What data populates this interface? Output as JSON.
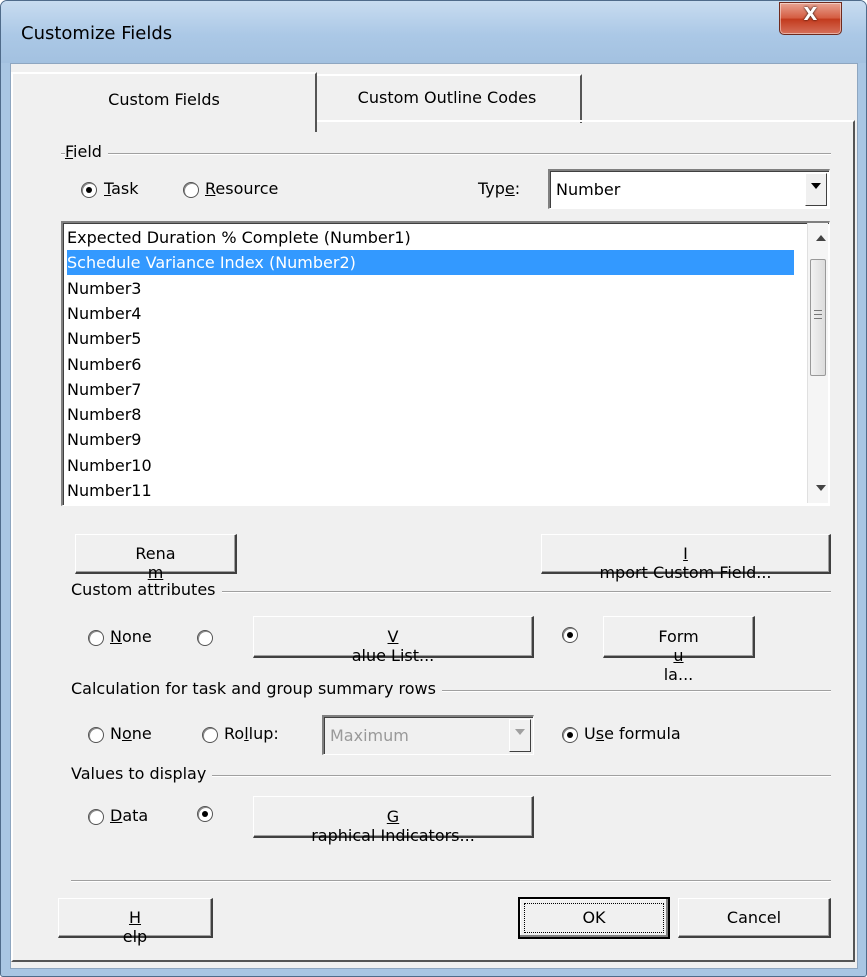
{
  "window": {
    "title": "Customize Fields",
    "close_glyph": "X"
  },
  "tabs": [
    {
      "label": "Custom Fields"
    },
    {
      "label": "Custom Outline Codes"
    }
  ],
  "field": {
    "group_label": "Field",
    "task_label": "Task",
    "resource_label": "Resource",
    "task_selected": true,
    "type_label": "Type:",
    "type_value": "Number"
  },
  "list": {
    "items": [
      "Expected Duration % Complete (Number1)",
      "Schedule Variance Index (Number2)",
      "Number3",
      "Number4",
      "Number5",
      "Number6",
      "Number7",
      "Number8",
      "Number9",
      "Number10",
      "Number11"
    ],
    "selected_index": 1
  },
  "buttons": {
    "rename": "Rename...",
    "import": "Import Custom Field..."
  },
  "custom_attributes": {
    "group_label": "Custom attributes",
    "none_label": "None",
    "value_list": "Value List...",
    "formula": "Formula..."
  },
  "calculation": {
    "group_label": "Calculation for task and group summary rows",
    "none_label": "None",
    "rollup_label": "Rollup:",
    "rollup_value": "Maximum",
    "use_formula_label": "Use formula"
  },
  "values_display": {
    "group_label": "Values to display",
    "data_label": "Data",
    "graphical_indicators": "Graphical Indicators..."
  },
  "footer": {
    "help": "Help",
    "ok": "OK",
    "cancel": "Cancel"
  }
}
